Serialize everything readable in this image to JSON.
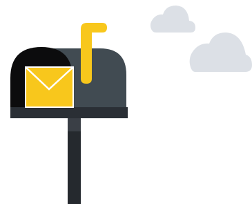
{
  "illustration": {
    "subject": "mailbox-with-letter",
    "icons": [
      "cloud-icon",
      "cloud-icon",
      "mailbox-icon",
      "envelope-icon",
      "flag-icon"
    ],
    "colors": {
      "background": "#ffffff",
      "cloud": "#dce0e6",
      "mailbox_front": "#0c0c0d",
      "mailbox_body": "#414b52",
      "mailbox_base": "#2a2f35",
      "post": "#25292e",
      "post_joint": "#3a3f46",
      "flag": "#f8c71c",
      "envelope": "#f8c71c",
      "envelope_fold": "#ffffff"
    }
  }
}
